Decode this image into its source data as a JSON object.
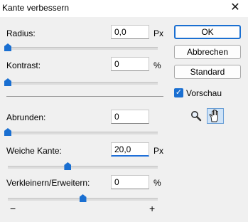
{
  "window": {
    "title": "Kante verbessern",
    "close_glyph": "✕"
  },
  "params": [
    {
      "label": "Radius:",
      "value": "0,0",
      "unit": "Px"
    },
    {
      "label": "Kontrast:",
      "value": "0",
      "unit": "%"
    },
    {
      "label": "Abrunden:",
      "value": "0",
      "unit": ""
    },
    {
      "label": "Weiche Kante:",
      "value": "20,0",
      "unit": "Px"
    },
    {
      "label": "Verkleinern/Erweitern:",
      "value": "0",
      "unit": "%"
    }
  ],
  "slider_levels": {
    "radius": 0.0,
    "kontrast": 0.0,
    "abrunden": 0.0,
    "weiche_kante": 0.4,
    "verkleinern_erweitern": 0.5
  },
  "shrink_expand": {
    "minus": "−",
    "plus": "+"
  },
  "buttons": {
    "ok": "OK",
    "cancel": "Abbrechen",
    "default": "Standard"
  },
  "preview": {
    "label": "Vorschau",
    "checked": true,
    "check_glyph": "✓"
  },
  "tools": [
    "zoom-icon",
    "hand-icon"
  ],
  "colors": {
    "accent": "#1a6fd1",
    "background": "#f0f0f0"
  }
}
